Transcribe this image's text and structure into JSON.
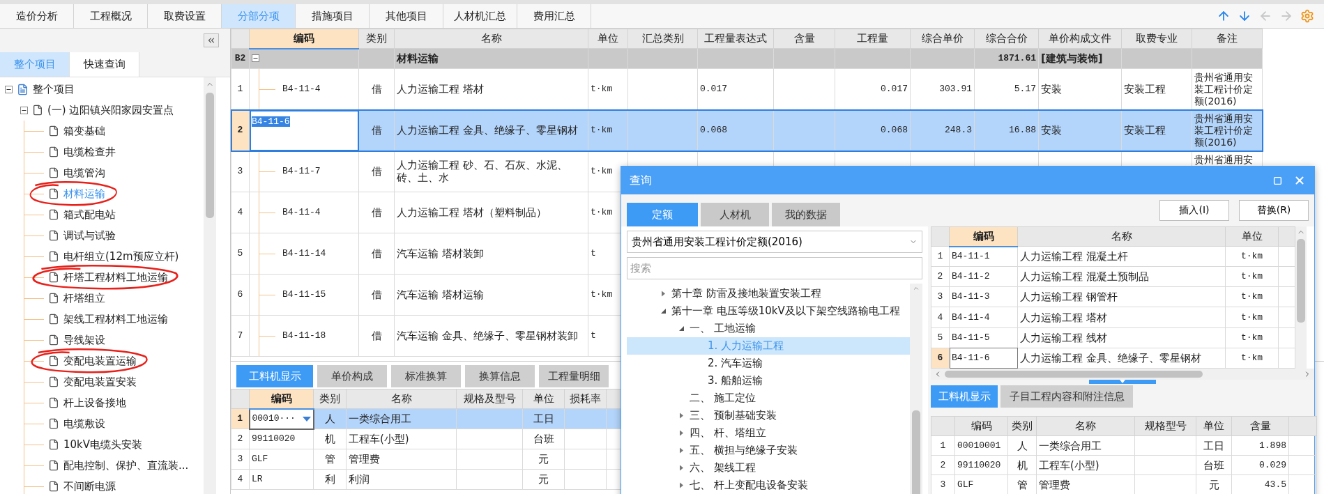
{
  "top_tabs": [
    {
      "label": "造价分析",
      "selected": false
    },
    {
      "label": "工程概况",
      "selected": false
    },
    {
      "label": "取费设置",
      "selected": false
    },
    {
      "label": "分部分项",
      "selected": true
    },
    {
      "label": "措施项目",
      "selected": false
    },
    {
      "label": "其他项目",
      "selected": false
    },
    {
      "label": "人材机汇总",
      "selected": false
    },
    {
      "label": "费用汇总",
      "selected": false
    }
  ],
  "toolbar": [
    {
      "kind": "up",
      "disabled": false
    },
    {
      "kind": "down",
      "disabled": false
    },
    {
      "kind": "left",
      "disabled": true
    },
    {
      "kind": "right",
      "disabled": true
    },
    {
      "kind": "settings",
      "disabled": false
    }
  ],
  "sidebar": {
    "tabs": [
      {
        "label": "整个项目",
        "selected": true
      },
      {
        "label": "快速查询",
        "selected": false
      }
    ],
    "tree": [
      {
        "label": "整个项目",
        "kind": "project",
        "expanded": true,
        "selected": false,
        "children": [
          {
            "label": "(一) 边阳镇兴阳家园安置点",
            "kind": "unit",
            "expanded": true,
            "selected": false,
            "children": [
              {
                "label": "箱变基础",
                "kind": "item",
                "selected": false,
                "circled": false
              },
              {
                "label": "电缆检查井",
                "kind": "item",
                "selected": false,
                "circled": false
              },
              {
                "label": "电缆管沟",
                "kind": "item",
                "selected": false,
                "circled": false
              },
              {
                "label": "材料运输",
                "kind": "item",
                "selected": true,
                "circled": true
              },
              {
                "label": "箱式配电站",
                "kind": "item",
                "selected": false,
                "circled": false
              },
              {
                "label": "调试与试验",
                "kind": "item",
                "selected": false,
                "circled": false
              },
              {
                "label": "电杆组立(12m预应立杆)",
                "kind": "item",
                "selected": false,
                "circled": false
              },
              {
                "label": "杆塔工程材料工地运输",
                "kind": "item",
                "selected": false,
                "circled": true
              },
              {
                "label": "杆塔组立",
                "kind": "item",
                "selected": false,
                "circled": false
              },
              {
                "label": "架线工程材料工地运输",
                "kind": "item",
                "selected": false,
                "circled": false
              },
              {
                "label": "导线架设",
                "kind": "item",
                "selected": false,
                "circled": false
              },
              {
                "label": "变配电装置运输",
                "kind": "item",
                "selected": false,
                "circled": true
              },
              {
                "label": "变配电装置安装",
                "kind": "item",
                "selected": false,
                "circled": false
              },
              {
                "label": "杆上设备接地",
                "kind": "item",
                "selected": false,
                "circled": false
              },
              {
                "label": "电缆敷设",
                "kind": "item",
                "selected": false,
                "circled": false
              },
              {
                "label": "10kV电缆头安装",
                "kind": "item",
                "selected": false,
                "circled": false
              },
              {
                "label": "配电控制、保护、直流装...",
                "kind": "item",
                "selected": false,
                "circled": false
              },
              {
                "label": "不间断电源",
                "kind": "item",
                "selected": false,
                "circled": false
              }
            ]
          }
        ]
      }
    ]
  },
  "main_table": {
    "columns": [
      "编码",
      "类别",
      "名称",
      "单位",
      "汇总类别",
      "工程量表达式",
      "含量",
      "工程量",
      "综合单价",
      "综合合价",
      "单价构成文件",
      "取费专业",
      "备注"
    ],
    "group": {
      "number": "B2",
      "expanded": true,
      "name": "材料运输",
      "total": "1871.61",
      "file": "[建筑与装饰]"
    },
    "rows": [
      {
        "number": "1",
        "code": "B4-11-4",
        "type": "借",
        "name": "人力运输工程 塔材",
        "unit": "t·km",
        "expr": "0.017",
        "qty": "0.017",
        "price": "303.91",
        "total": "5.17",
        "file": "安装",
        "fee": "安装工程",
        "remark": "贵州省通用安装工程计价定额(2016)",
        "selected": false
      },
      {
        "number": "2",
        "code": "B4-11-6",
        "type": "借",
        "name": "人力运输工程 金具、绝缘子、零星钢材",
        "unit": "t·km",
        "expr": "0.068",
        "qty": "0.068",
        "price": "248.3",
        "total": "16.88",
        "file": "安装",
        "fee": "安装工程",
        "remark": "贵州省通用安装工程计价定额(2016)",
        "selected": true
      },
      {
        "number": "3",
        "code": "B4-11-7",
        "type": "借",
        "name": "人力运输工程 砂、石、石灰、水泥、砖、土、水",
        "unit": "t·km",
        "remark": "贵州省通用安",
        "selected": false
      },
      {
        "number": "4",
        "code": "B4-11-4",
        "type": "借",
        "name": "人力运输工程 塔材（塑料制品）",
        "unit": "t·km",
        "selected": false
      },
      {
        "number": "5",
        "code": "B4-11-14",
        "type": "借",
        "name": "汽车运输 塔材装卸",
        "unit": "t",
        "selected": false
      },
      {
        "number": "6",
        "code": "B4-11-15",
        "type": "借",
        "name": "汽车运输 塔材运输",
        "unit": "t·km",
        "selected": false
      },
      {
        "number": "7",
        "code": "B4-11-18",
        "type": "借",
        "name": "汽车运输 金具、绝缘子、零星钢材装卸",
        "unit": "t",
        "selected": false
      }
    ]
  },
  "bottom_panel": {
    "tabs": [
      {
        "label": "工料机显示",
        "selected": true
      },
      {
        "label": "单价构成",
        "selected": false
      },
      {
        "label": "标准换算",
        "selected": false
      },
      {
        "label": "换算信息",
        "selected": false
      },
      {
        "label": "工程量明细",
        "selected": false
      }
    ],
    "columns": [
      "编码",
      "类别",
      "名称",
      "规格及型号",
      "单位",
      "损耗率"
    ],
    "rows": [
      {
        "number": "1",
        "code": "00010···",
        "type": "人",
        "name": "一类综合用工",
        "unit": "工日",
        "selected": true
      },
      {
        "number": "2",
        "code": "99110020",
        "type": "机",
        "name": "工程车(小型)",
        "unit": "台班",
        "selected": false
      },
      {
        "number": "3",
        "code": "GLF",
        "type": "管",
        "name": "管理费",
        "unit": "元",
        "selected": false
      },
      {
        "number": "4",
        "code": "LR",
        "type": "利",
        "name": "利润",
        "unit": "元",
        "selected": false
      }
    ]
  },
  "dialog": {
    "title": "查询",
    "tabs": [
      {
        "label": "定额",
        "selected": true
      },
      {
        "label": "人材机",
        "selected": false
      },
      {
        "label": "我的数据",
        "selected": false
      }
    ],
    "buttons": [
      "插入(I)",
      "替换(R)"
    ],
    "library": "贵州省通用安装工程计价定额(2016)",
    "search": {
      "placeholder": "搜索"
    },
    "tree": [
      {
        "label": "第十章 防雷及接地装置安装工程",
        "expanded": false,
        "selected": false
      },
      {
        "label": "第十一章 电压等级10kV及以下架空线路输电工程",
        "expanded": true,
        "selected": false,
        "children": [
          {
            "label": "一、 工地运输",
            "expanded": true,
            "selected": false,
            "children": [
              {
                "label": "1. 人力运输工程",
                "selected": true
              },
              {
                "label": "2. 汽车运输",
                "selected": false
              },
              {
                "label": "3. 船舶运输",
                "selected": false
              }
            ]
          },
          {
            "label": "二、 施工定位",
            "selected": false
          },
          {
            "label": "三、 预制基础安装",
            "expanded": false,
            "selected": false
          },
          {
            "label": "四、 杆、塔组立",
            "expanded": false,
            "selected": false
          },
          {
            "label": "五、 横担与绝缘子安装",
            "expanded": false,
            "selected": false
          },
          {
            "label": "六、 架线工程",
            "expanded": false,
            "selected": false
          },
          {
            "label": "七、 杆上变配电设备安装",
            "expanded": false,
            "selected": false
          }
        ]
      }
    ],
    "quota_table": {
      "columns": [
        "编码",
        "名称",
        "单位"
      ],
      "rows": [
        {
          "number": "1",
          "code": "B4-11-1",
          "name": "人力运输工程 混凝土杆",
          "unit": "t·km",
          "selected": false
        },
        {
          "number": "2",
          "code": "B4-11-2",
          "name": "人力运输工程 混凝土预制品",
          "unit": "t·km",
          "selected": false
        },
        {
          "number": "3",
          "code": "B4-11-3",
          "name": "人力运输工程 钢管杆",
          "unit": "t·km",
          "selected": false
        },
        {
          "number": "4",
          "code": "B4-11-4",
          "name": "人力运输工程 塔材",
          "unit": "t·km",
          "selected": false
        },
        {
          "number": "5",
          "code": "B4-11-5",
          "name": "人力运输工程 线材",
          "unit": "t·km",
          "selected": false
        },
        {
          "number": "6",
          "code": "B4-11-6",
          "name": "人力运输工程 金具、绝缘子、零星钢材",
          "unit": "t·km",
          "selected": true
        }
      ]
    },
    "detail_tabs": [
      {
        "label": "工料机显示",
        "selected": true
      },
      {
        "label": "子目工程内容和附注信息",
        "selected": false
      }
    ],
    "detail_table": {
      "columns": [
        "编码",
        "类别",
        "名称",
        "规格型号",
        "单位",
        "含量"
      ],
      "rows": [
        {
          "number": "1",
          "code": "00010001",
          "type": "人",
          "name": "一类综合用工",
          "unit": "工日",
          "amount": "1.898"
        },
        {
          "number": "2",
          "code": "99110020",
          "type": "机",
          "name": "工程车(小型)",
          "unit": "台班",
          "amount": "0.029"
        },
        {
          "number": "3",
          "code": "GLF",
          "type": "管",
          "name": "管理费",
          "unit": "元",
          "amount": "43.5"
        }
      ]
    }
  }
}
